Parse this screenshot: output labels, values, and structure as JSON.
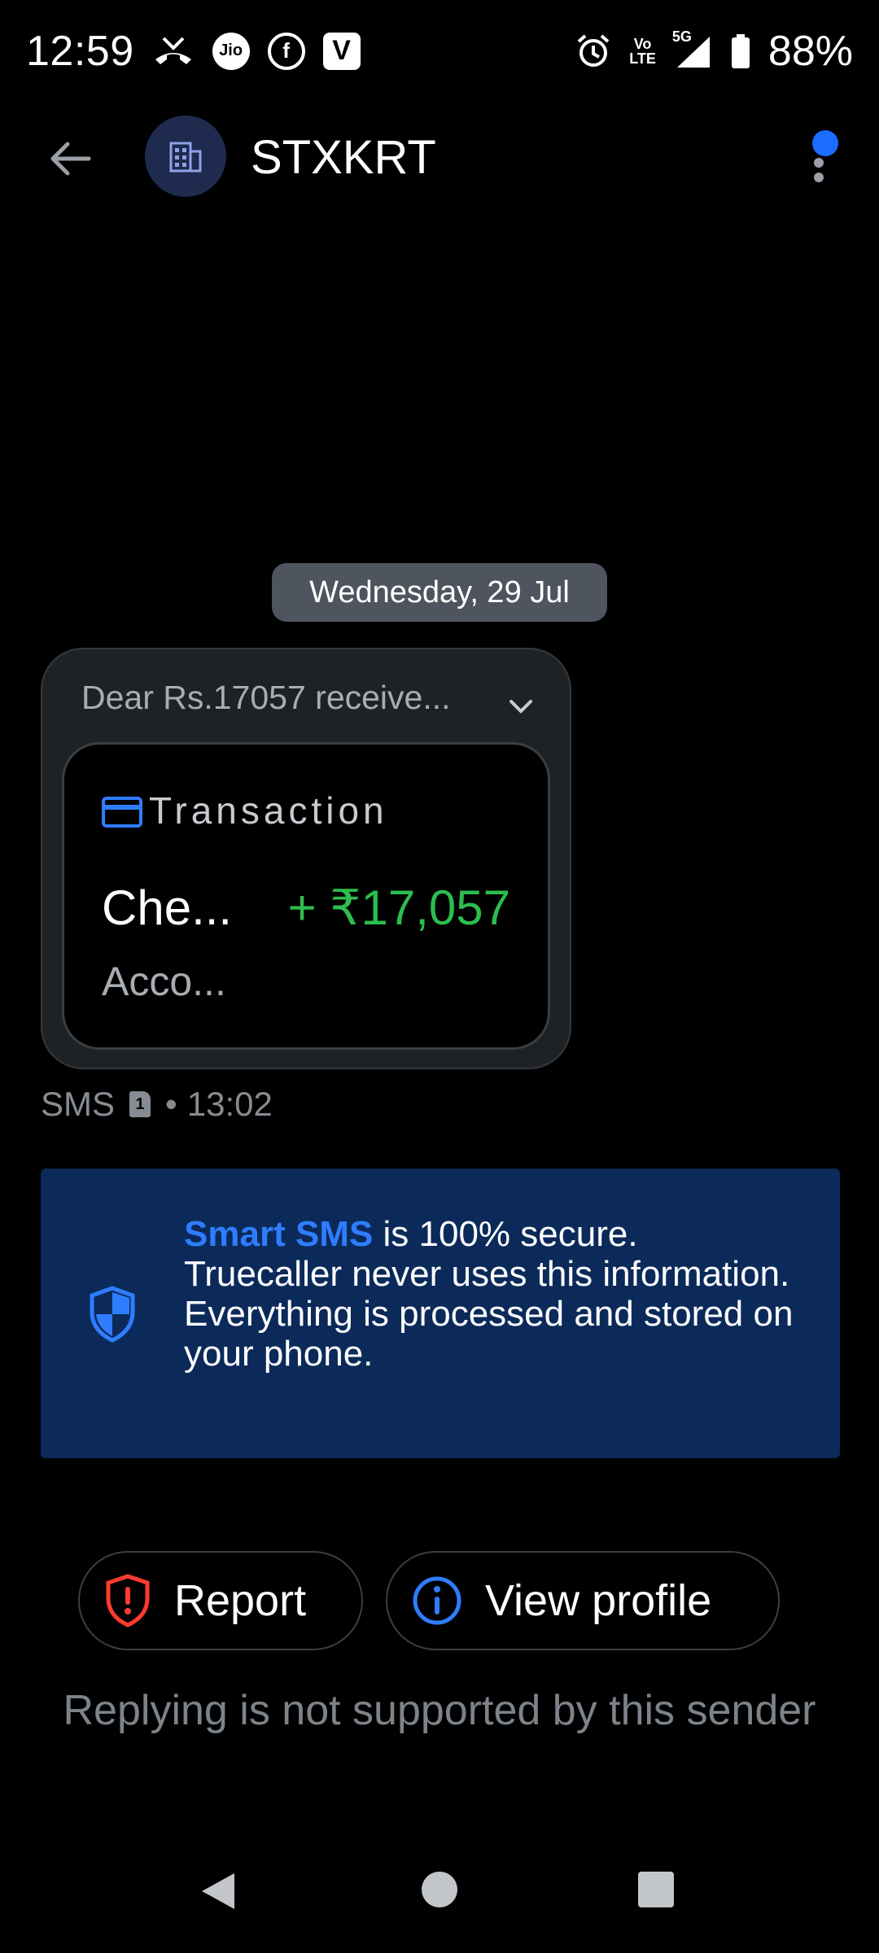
{
  "status_bar": {
    "time": "12:59",
    "icons_left": [
      "missed-call-icon",
      "jio-icon",
      "facebook-icon",
      "vi-icon"
    ],
    "jio_label": "Jio",
    "vi_label": "V",
    "facebook_label": "f",
    "volte_label_top": "Vo",
    "volte_label_bottom": "LTE",
    "network_label": "5G",
    "battery": "88%"
  },
  "header": {
    "sender": "STXKRT",
    "avatar_icon": "building-icon"
  },
  "conversation": {
    "date": "Wednesday, 29 Jul",
    "message": {
      "preview": "Dear Rs.17057 receive...",
      "card": {
        "type_label": "Transaction",
        "title": "Che...",
        "amount": "+ ₹17,057",
        "subtitle": "Acco..."
      },
      "meta": {
        "channel": "SMS",
        "sim": "1",
        "separator": "•",
        "time": "13:02"
      }
    }
  },
  "banner": {
    "brand": "Smart SMS",
    "text": " is 100% secure. Truecaller never uses this information. Everything is processed and stored on your phone."
  },
  "actions": {
    "report_label": "Report",
    "view_profile_label": "View profile"
  },
  "reply_note": "Replying is not supported by this sender",
  "colors": {
    "accent": "#1a6dff",
    "amount_green": "#2dbd4e",
    "report_red": "#ff3b30",
    "banner_bg": "#0b2a5a"
  }
}
